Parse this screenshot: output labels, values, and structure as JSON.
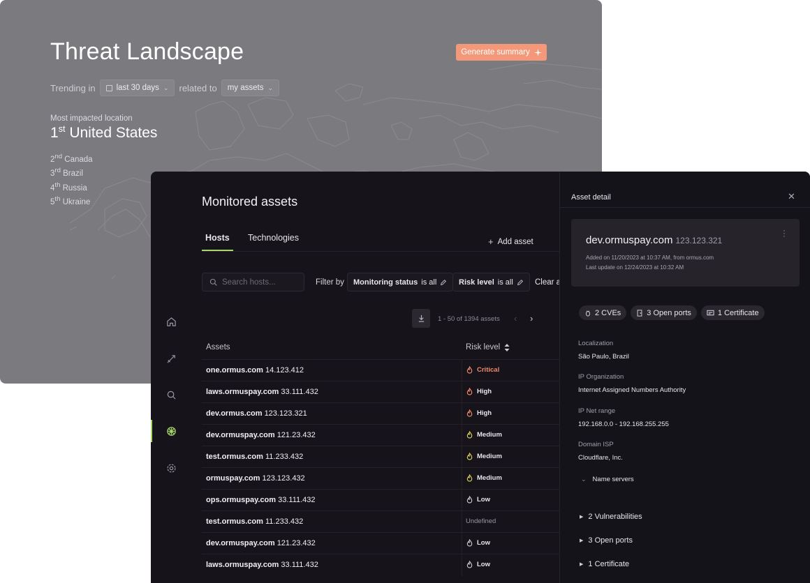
{
  "threat": {
    "title": "Threat Landscape",
    "generate_label": "Generate summary",
    "trending_label": "Trending in",
    "range": "last 30 days",
    "related_label": "related to",
    "scope": "my assets",
    "most_impacted_label": "Most impacted location",
    "top": {
      "rank": "1",
      "suffix": "st",
      "country": "United States"
    },
    "ranks": [
      {
        "rank": "2",
        "suffix": "nd",
        "country": "Canada"
      },
      {
        "rank": "3",
        "suffix": "rd",
        "country": "Brazil"
      },
      {
        "rank": "4",
        "suffix": "th",
        "country": "Russia"
      },
      {
        "rank": "5",
        "suffix": "th",
        "country": "Ukraine"
      }
    ]
  },
  "monitored": {
    "title": "Monitored assets",
    "tabs": [
      {
        "label": "Hosts",
        "active": true
      },
      {
        "label": "Technologies",
        "active": false
      }
    ],
    "add_asset": "Add asset",
    "search_placeholder": "Search hosts...",
    "filter_by": "Filter by",
    "filters": [
      {
        "name": "Monitoring status",
        "value": "is all"
      },
      {
        "name": "Risk level",
        "value": "is all"
      }
    ],
    "clear_label": "Clear all",
    "pager": "1 - 50 of 1394 assets",
    "columns": {
      "assets": "Assets",
      "risk": "Risk level"
    },
    "rows": [
      {
        "host": "one.ormus.com",
        "ip": "14.123.412",
        "risk": "Critical",
        "level": "critical"
      },
      {
        "host": "laws.ormuspay.com",
        "ip": "33.111.432",
        "risk": "High",
        "level": "high"
      },
      {
        "host": "dev.ormus.com",
        "ip": "123.123.321",
        "risk": "High",
        "level": "high"
      },
      {
        "host": "dev.ormuspay.com",
        "ip": "121.23.432",
        "risk": "Medium",
        "level": "medium"
      },
      {
        "host": "test.ormus.com",
        "ip": "11.233.432",
        "risk": "Medium",
        "level": "medium"
      },
      {
        "host": "ormuspay.com",
        "ip": "123.123.432",
        "risk": "Medium",
        "level": "medium"
      },
      {
        "host": "ops.ormuspay.com",
        "ip": "33.111.432",
        "risk": "Low",
        "level": "low"
      },
      {
        "host": "test.ormus.com",
        "ip": "11.233.432",
        "risk": "Undefined",
        "level": "undefined"
      },
      {
        "host": "dev.ormuspay.com",
        "ip": "121.23.432",
        "risk": "Low",
        "level": "low"
      },
      {
        "host": "laws.ormuspay.com",
        "ip": "33.111.432",
        "risk": "Low",
        "level": "low"
      }
    ]
  },
  "detail": {
    "title": "Asset detail",
    "host": "dev.ormuspay.com",
    "ip": "123.123.321",
    "added": "Added on 11/20/2023 at 10:37 AM, from ormus.com",
    "updated": "Last update on 12/24/2023 at 10:32 AM",
    "badges": [
      {
        "icon": "bug-icon",
        "label": "2 CVEs"
      },
      {
        "icon": "door-icon",
        "label": "3 Open ports"
      },
      {
        "icon": "certificate-icon",
        "label": "1 Certificate"
      }
    ],
    "fields": [
      {
        "label": "Localization",
        "value": "São Paulo, Brazil"
      },
      {
        "label": "IP Organization",
        "value": "Internet Assigned Numbers Authority"
      },
      {
        "label": "IP Net range",
        "value": "192.168.0.0 - 192.168.255.255"
      },
      {
        "label": "Domain ISP",
        "value": "Cloudflare, Inc."
      }
    ],
    "name_servers": "Name servers",
    "sections": [
      "2 Vulnerabilities",
      "3 Open ports",
      "1 Certificate"
    ]
  },
  "colors": {
    "accent": "#a6d96a",
    "critical": "#f08a6c",
    "high": "#f08a6c",
    "medium": "#d8cf55",
    "low": "#c9c6ce",
    "generate_button": "#f4987a"
  }
}
